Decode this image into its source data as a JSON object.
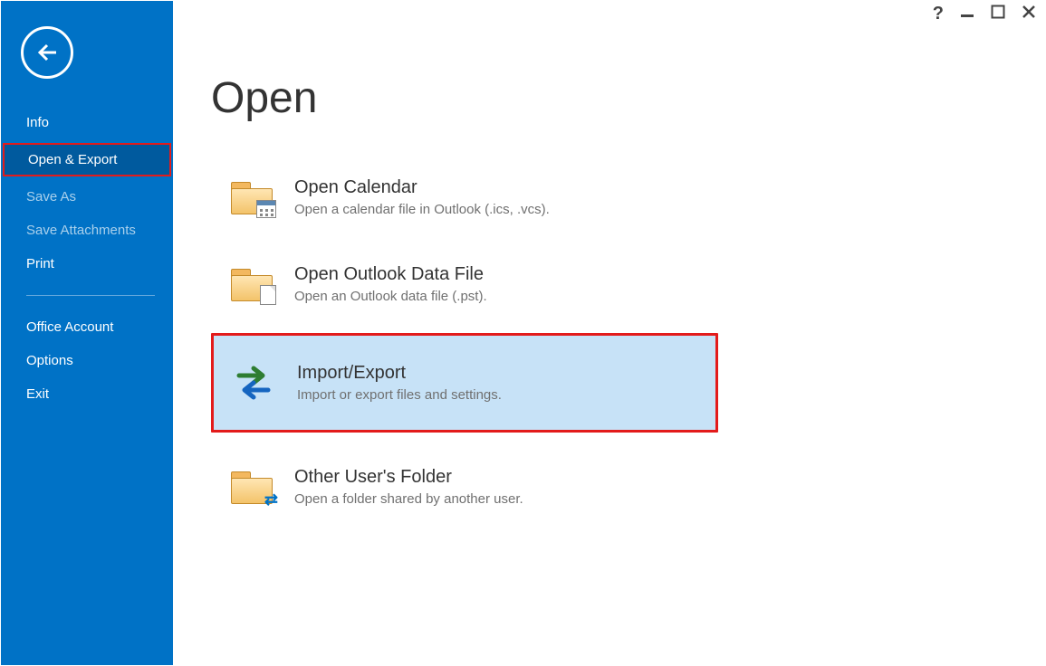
{
  "colors": {
    "brand": "#0072c6",
    "sidebar_selected_bg": "#005a9e",
    "highlight_bg": "#c7e2f7",
    "annotation_border": "#e31b1b"
  },
  "sidebar": {
    "items": [
      {
        "id": "info",
        "label": "Info",
        "dim": false,
        "selected": false
      },
      {
        "id": "open-export",
        "label": "Open & Export",
        "dim": false,
        "selected": true
      },
      {
        "id": "save-as",
        "label": "Save As",
        "dim": true,
        "selected": false
      },
      {
        "id": "save-attachments",
        "label": "Save Attachments",
        "dim": true,
        "selected": false
      },
      {
        "id": "print",
        "label": "Print",
        "dim": false,
        "selected": false
      }
    ],
    "lower_items": [
      {
        "id": "office-account",
        "label": "Office Account"
      },
      {
        "id": "options",
        "label": "Options"
      },
      {
        "id": "exit",
        "label": "Exit"
      }
    ]
  },
  "page": {
    "title": "Open",
    "options": [
      {
        "id": "open-calendar",
        "title": "Open Calendar",
        "desc": "Open a calendar file in Outlook (.ics, .vcs).",
        "icon": "folder-calendar",
        "highlight": false
      },
      {
        "id": "open-data-file",
        "title": "Open Outlook Data File",
        "desc": "Open an Outlook data file (.pst).",
        "icon": "folder-page",
        "highlight": false
      },
      {
        "id": "import-export",
        "title": "Import/Export",
        "desc": "Import or export files and settings.",
        "icon": "import-export-arrows",
        "highlight": true
      },
      {
        "id": "other-users-folder",
        "title": "Other User's Folder",
        "desc": "Open a folder shared by another user.",
        "icon": "folder-share",
        "highlight": false
      }
    ]
  }
}
